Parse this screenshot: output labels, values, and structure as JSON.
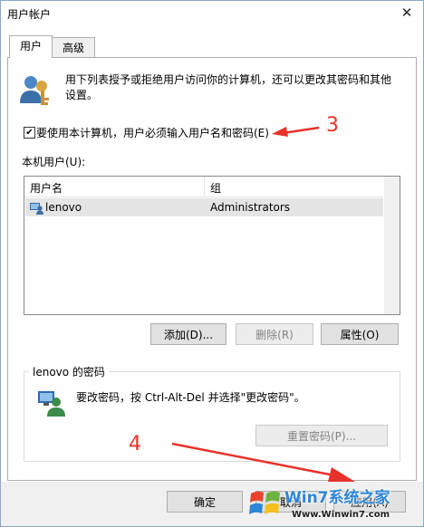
{
  "window": {
    "title": "用户帐户"
  },
  "tabs": [
    {
      "label": "用户",
      "active": true
    },
    {
      "label": "高级",
      "active": false
    }
  ],
  "intro": {
    "text": "用下列表授予或拒绝用户访问你的计算机，还可以更改其密码和其他设置。"
  },
  "require_login": {
    "label": "要使用本计算机，用户必须输入用户名和密码(E)",
    "checked": true,
    "check_glyph": "✔"
  },
  "users_section": {
    "label": "本机用户(U):",
    "columns": [
      "用户名",
      "组"
    ],
    "rows": [
      {
        "name": "lenovo",
        "group": "Administrators"
      }
    ]
  },
  "buttons": {
    "add": "添加(D)...",
    "remove": "删除(R)",
    "properties": "属性(O)",
    "reset_password": "重置密码(P)...",
    "ok": "确定",
    "cancel": "取消",
    "apply": "应用(A)"
  },
  "password_group": {
    "title": "lenovo 的密码",
    "text": "要改密码，按 Ctrl-Alt-Del 并选择\"更改密码\"。"
  },
  "annotations": {
    "step3": "3",
    "step4": "4"
  },
  "watermark": {
    "brand": "Win7系统之家",
    "url": "Www.Winwin7.com"
  },
  "colors": {
    "annotation_red": "#e8322a",
    "selection_gray": "#e5e5e5",
    "accent_blue": "#3c7fb1"
  }
}
